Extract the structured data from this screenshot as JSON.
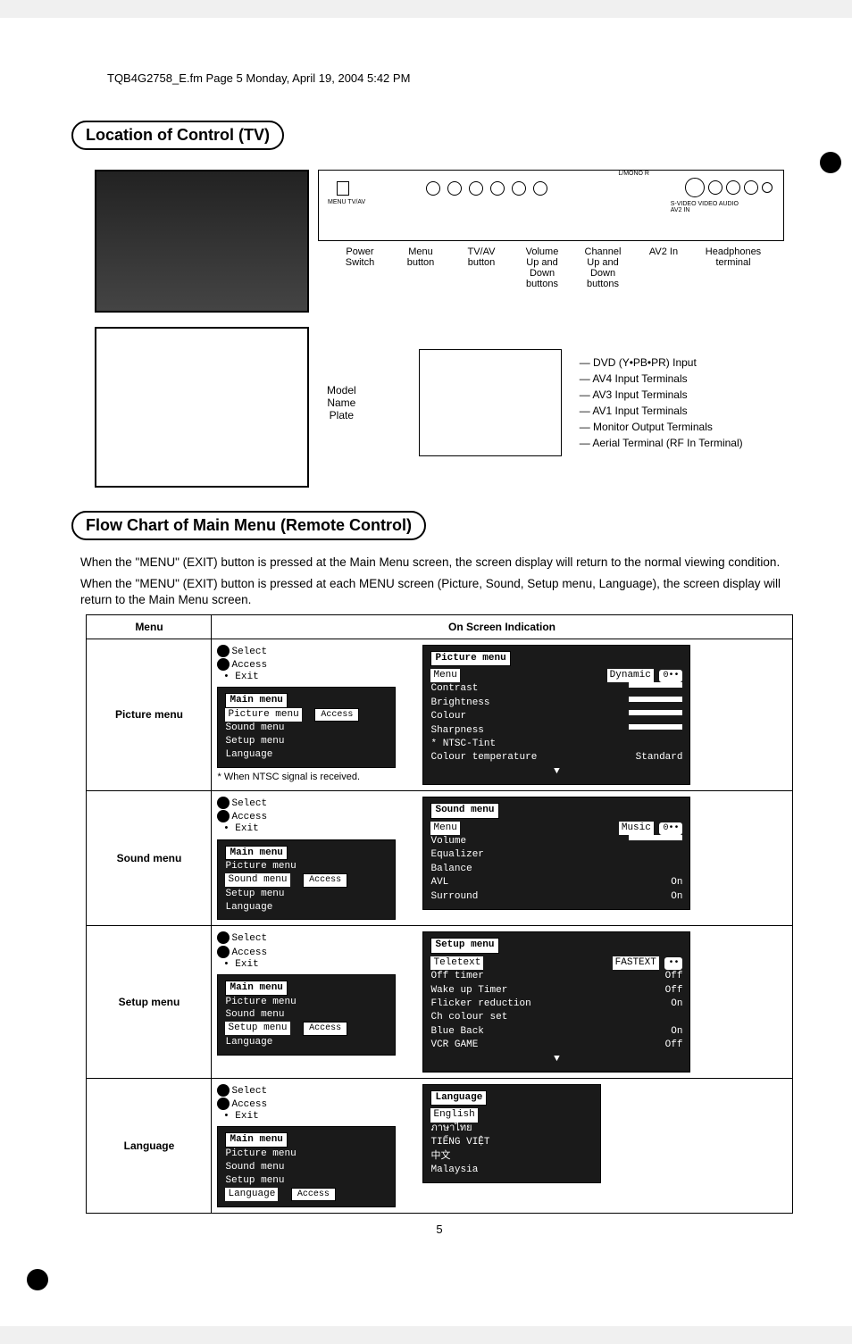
{
  "header": {
    "file_line": "TQB4G2758_E.fm Page 5 Monday, April 19, 2004 5:42 PM"
  },
  "sections": {
    "location_title": "Location of Control (TV)",
    "flow_title": "Flow Chart of Main Menu (Remote Control)"
  },
  "tv_controls": {
    "power": "Power\nSwitch",
    "menu": "Menu\nbutton",
    "tvav": "TV/AV\nbutton",
    "volume": "Volume\nUp and\nDown\nbuttons",
    "channel": "Channel\nUp and\nDown\nbuttons",
    "av2": "AV2 In",
    "hp": "Headphones\nterminal",
    "panel_text_menutvav": "MENU TV/AV",
    "panel_text_svideo": "S-VIDEO  VIDEO  AUDIO",
    "panel_text_av2": "AV2  IN",
    "panel_text_lmono": "L/MONO   R",
    "model_plate": "Model\nName\nPlate"
  },
  "rear_labels": {
    "dvd": "DVD (Y•PB•PR) Input",
    "av4": "AV4 Input Terminals",
    "av3": "AV3 Input Terminals",
    "av1": "AV1 Input Terminals",
    "monitor": "Monitor Output Terminals",
    "aerial": "Aerial Terminal (RF In Terminal)"
  },
  "flow_intro": {
    "p1": "When the \"MENU\" (EXIT) button is pressed at the Main Menu screen, the screen display will return to the normal viewing condition.",
    "p2": "When the \"MENU\" (EXIT) button is pressed at each MENU screen (Picture, Sound, Setup menu, Language), the screen display will return to the Main Menu screen."
  },
  "table": {
    "th_menu": "Menu",
    "th_osi": "On Screen Indication",
    "hints": {
      "select": "Select",
      "access": "Access",
      "exit": "Exit"
    },
    "main_menu_title": "Main menu",
    "access_label": "Access",
    "ntsc_note": "* When NTSC signal is received.",
    "rows": {
      "picture": {
        "label": "Picture menu",
        "items": [
          "Picture menu",
          "Sound menu",
          "Setup menu",
          "Language"
        ],
        "highlight": 0,
        "sub_title": "Picture menu",
        "sub_rows": [
          {
            "k": "Menu",
            "v": "Dynamic",
            "hl": true,
            "pill": true
          },
          {
            "k": "Contrast",
            "v": "",
            "slider": true
          },
          {
            "k": "Brightness",
            "v": "",
            "slider": true
          },
          {
            "k": "Colour",
            "v": "",
            "slider": true
          },
          {
            "k": "Sharpness",
            "v": "",
            "slider": true
          },
          {
            "k": "NTSC-Tint",
            "v": "",
            "star": true
          },
          {
            "k": "Colour temperature",
            "v": "Standard"
          }
        ]
      },
      "sound": {
        "label": "Sound menu",
        "items": [
          "Picture menu",
          "Sound menu",
          "Setup menu",
          "Language"
        ],
        "highlight": 1,
        "sub_title": "Sound menu",
        "sub_rows": [
          {
            "k": "Menu",
            "v": "Music",
            "hl": true,
            "pill": true
          },
          {
            "k": "Volume",
            "v": "",
            "slider": true
          },
          {
            "k": "Equalizer",
            "v": ""
          },
          {
            "k": "Balance",
            "v": ""
          },
          {
            "k": "AVL",
            "v": "On"
          },
          {
            "k": "Surround",
            "v": "On"
          }
        ]
      },
      "setup": {
        "label": "Setup menu",
        "items": [
          "Picture menu",
          "Sound menu",
          "Setup menu",
          "Language"
        ],
        "highlight": 2,
        "sub_title": "Setup menu",
        "sub_rows": [
          {
            "k": "Teletext",
            "v": "FASTEXT",
            "hl": true,
            "pill": true
          },
          {
            "k": "Off timer",
            "v": "Off"
          },
          {
            "k": "Wake up Timer",
            "v": "Off"
          },
          {
            "k": "Flicker reduction",
            "v": "On"
          },
          {
            "k": "Ch colour set",
            "v": ""
          },
          {
            "k": "Blue Back",
            "v": "On"
          },
          {
            "k": "VCR GAME",
            "v": "Off"
          }
        ]
      },
      "language": {
        "label": "Language",
        "items": [
          "Picture menu",
          "Sound menu",
          "Setup menu",
          "Language"
        ],
        "highlight": 3,
        "sub_title": "Language",
        "sub_rows": [
          {
            "k": "English",
            "hl": true
          },
          {
            "k": "ภาษาไทย"
          },
          {
            "k": "TIẾNG VIỆT"
          },
          {
            "k": "中文"
          },
          {
            "k": "Malaysia"
          }
        ]
      }
    }
  },
  "page_number": "5"
}
